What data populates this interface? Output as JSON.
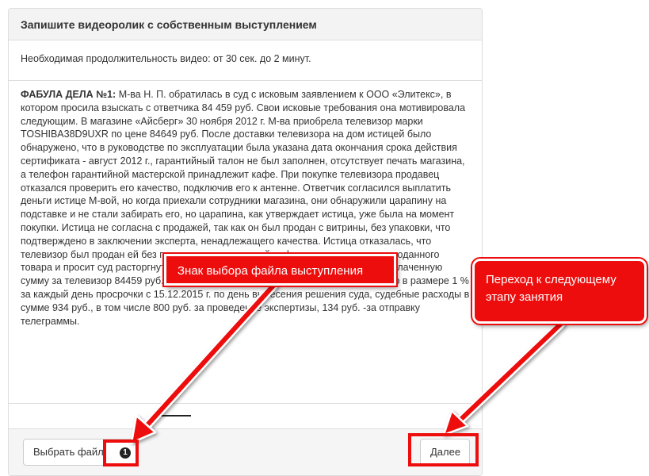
{
  "panel": {
    "title": "Запишите видеоролик с собственным выступлением",
    "note": "Необходимая продолжительность видео: от 30 сек. до 2 минут.",
    "case_heading": "ФАБУЛА ДЕЛА №1:",
    "case_text": "М-ва Н. П. обратилась в суд с исковым заявлением к ООО «Элитекс», в котором просила взыскать с ответчика 84 459 руб. Свои исковые требования она мотивировала следующим. В магазине «Айсберг» 30 ноября 2012 г. М-ва приобрела телевизор марки TOSHIBA38D9UXR по цене 84649 руб. После доставки телевизора на дом истицей было обнаружено, что в руководстве по эксплуатации была указана дата окончания срока действия сертификата - август 2012 г., гарантийный талон не был заполнен, отсутствует печать магазина, а телефон гарантийной мастерской принадлежит кафе. При покупке телевизора продавец отказался проверить его качество, подключив его к антенне. Ответчик согласился выплатить деньги истице М-вой, но когда приехали сотрудники магазина, они обнаружили царапину на подставке и не стали забирать его, но царапина, как утверждает истица, уже была на момент покупки. Истица не согласна с продажей, так как он был продан с витрины, без упаковки, что подтверждено в заключении эксперта, ненадлежащего качества. Истица отказалась, что телевизор был продан ей без предоставления полной информации о качестве проданного товара и просит суд расторгнуть договор купли-продажи, взыскать с ответчика уплаченную сумму за телевизор 84459 руб., компенсацию морального вреда 40000 руб., пеню в размере 1 % за каждый день просрочки с 15.12.2015 г. по день вынесения решения суда, судебные расходы в сумме 934 руб., в том числе 800 руб. за проведение экспертизы, 134 руб. -за отправку телеграммы."
  },
  "footer": {
    "choose_file_label": "Выбрать файл",
    "file_badge": "1",
    "next_label": "Далее"
  },
  "annotations": {
    "file_callout": "Знак выбора файла выступления",
    "next_callout_line1": "Переход к следующему",
    "next_callout_line2": "этапу занятия"
  },
  "colors": {
    "annotation_red": "#ee0d0d",
    "panel_border": "#dddddd",
    "heading_bg": "#f3f3f3"
  }
}
